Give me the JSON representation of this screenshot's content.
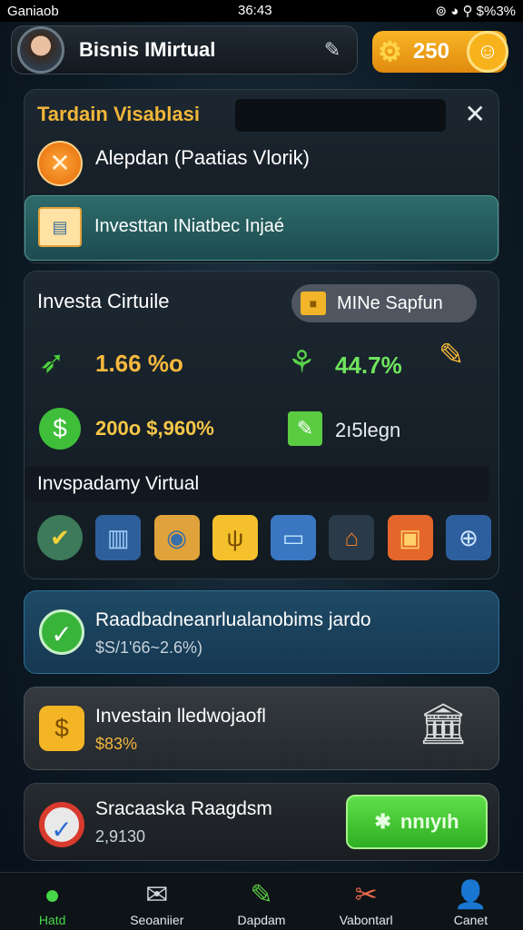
{
  "status": {
    "carrier": "Ganiaob",
    "time": "36:43",
    "right": "⊚ ◕ ⚲ $%3%"
  },
  "header": {
    "title": "Bisnis IMirtual",
    "coins": "250"
  },
  "panel": {
    "head": "Tardain Visablasi",
    "subtitle": "Alepdan (Paatias Vlorik)",
    "banner": "Investtan INiatbec Injaé"
  },
  "invest": {
    "head": "Investa Cirtuile",
    "mine_button": "MINe Sapfun",
    "stats": [
      "1.66 %o",
      "44.7%",
      "200o $,960%",
      "2ı5legn"
    ],
    "section": "Invspadamy Virtual",
    "icons": [
      "gear-check-icon",
      "desk-icon",
      "safe-icon",
      "card-icon",
      "monitor-icon",
      "factory-icon",
      "shop-icon",
      "globe-icon"
    ]
  },
  "rows": [
    {
      "title": "Raadbadneanrlualanobims jardo",
      "sub": "$S/1'66~2.6%)"
    },
    {
      "title": "Investain lledwojaofl",
      "sub": "$83%"
    },
    {
      "title": "Sracaaska Raagdsm",
      "sub": "2,9130",
      "button": "nnıyıh"
    }
  ],
  "nav": [
    "Hatd",
    "Seoaniier",
    "Dapdam",
    "Vabontarl",
    "Canet"
  ],
  "colors": {
    "accent": "#f2b63a",
    "green": "#47d64a"
  }
}
